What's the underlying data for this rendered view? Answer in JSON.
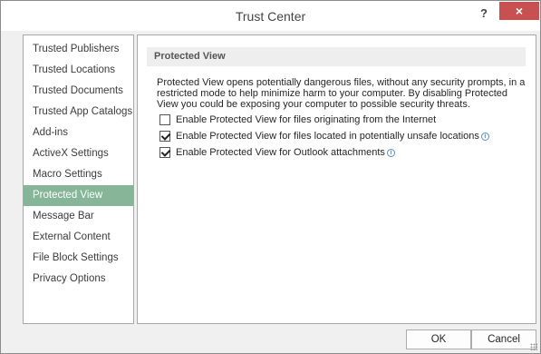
{
  "window": {
    "title": "Trust Center",
    "help_label": "?",
    "close_label": "×"
  },
  "sidebar": {
    "items": [
      {
        "label": "Trusted Publishers"
      },
      {
        "label": "Trusted Locations"
      },
      {
        "label": "Trusted Documents"
      },
      {
        "label": "Trusted App Catalogs"
      },
      {
        "label": "Add-ins"
      },
      {
        "label": "ActiveX Settings"
      },
      {
        "label": "Macro Settings"
      },
      {
        "label": "Protected View",
        "selected": true
      },
      {
        "label": "Message Bar"
      },
      {
        "label": "External Content"
      },
      {
        "label": "File Block Settings"
      },
      {
        "label": "Privacy Options"
      }
    ],
    "selected_color": "#86b597"
  },
  "main": {
    "section_title": "Protected View",
    "description": "Protected View opens potentially dangerous files, without any security prompts, in a restricted mode to help minimize harm to your computer. By disabling Protected View you could be exposing your computer to possible security threats.",
    "options": [
      {
        "label": "Enable Protected View for files originating from the Internet",
        "checked": false,
        "info": false
      },
      {
        "label": "Enable Protected View for files located in potentially unsafe locations",
        "checked": true,
        "info": true
      },
      {
        "label": "Enable Protected View for Outlook attachments",
        "checked": true,
        "info": true
      }
    ]
  },
  "footer": {
    "ok_label": "OK",
    "cancel_label": "Cancel"
  },
  "colors": {
    "close_button": "#c75050",
    "info_icon": "#4a8fd6"
  }
}
